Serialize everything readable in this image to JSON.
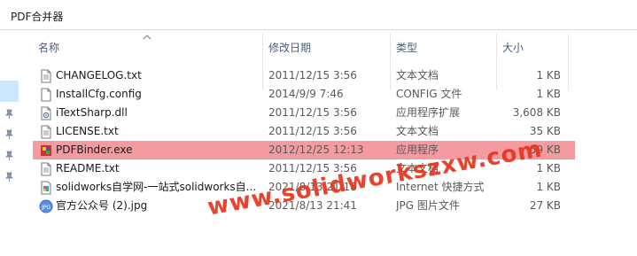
{
  "window": {
    "breadcrumb": "PDF合并器"
  },
  "columns": {
    "name": "名称",
    "date": "修改日期",
    "type": "类型",
    "size": "大小"
  },
  "files": [
    {
      "name": "CHANGELOG.txt",
      "date": "2011/12/15 3:56",
      "type": "文本文档",
      "size": "1 KB",
      "icon": "text-file-icon"
    },
    {
      "name": "InstallCfg.config",
      "date": "2014/9/9 7:46",
      "type": "CONFIG 文件",
      "size": "1 KB",
      "icon": "config-file-icon"
    },
    {
      "name": "iTextSharp.dll",
      "date": "2011/12/15 3:56",
      "type": "应用程序扩展",
      "size": "3,608 KB",
      "icon": "dll-file-icon"
    },
    {
      "name": "LICENSE.txt",
      "date": "2011/12/15 3:56",
      "type": "文本文档",
      "size": "35 KB",
      "icon": "text-file-icon"
    },
    {
      "name": "PDFBinder.exe",
      "date": "2012/12/25 12:13",
      "type": "应用程序",
      "size": "59 KB",
      "icon": "exe-app-icon",
      "selected": true
    },
    {
      "name": "README.txt",
      "date": "2011/12/15 3:56",
      "type": "文本文档",
      "size": "1 KB",
      "icon": "text-file-icon"
    },
    {
      "name": "solidworks自学网-一站式solidworks自...",
      "date": "2021/8/13 21:18",
      "type": "Internet 快捷方式",
      "size": "1 KB",
      "icon": "internet-shortcut-icon"
    },
    {
      "name": "官方公众号 (2).jpg",
      "date": "2021/8/13 21:41",
      "type": "JPG 图片文件",
      "size": "27 KB",
      "icon": "jpg-file-icon"
    }
  ],
  "watermark": "www.solidworkszxw.com",
  "colors": {
    "selection": "#f59aa1",
    "watermark": "#e8341c",
    "header_text": "#4a5d80"
  }
}
